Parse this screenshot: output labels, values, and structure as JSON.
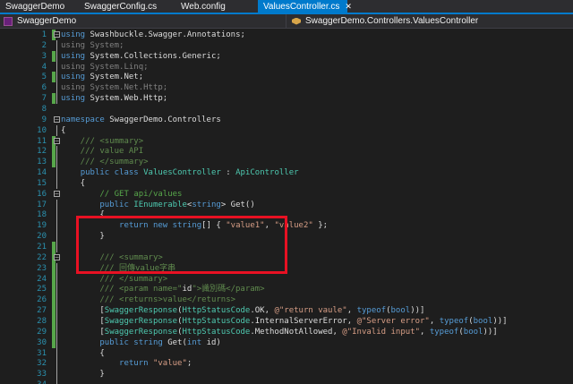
{
  "tabs": [
    {
      "label": "SwaggerDemo",
      "active": false
    },
    {
      "label": "SwaggerConfig.cs",
      "active": false
    },
    {
      "label": "Web.config",
      "active": false
    },
    {
      "label": "ValuesController.cs",
      "active": true
    }
  ],
  "nav": {
    "project": "SwaggerDemo",
    "class": "SwaggerDemo.Controllers.ValuesController"
  },
  "colors": {
    "keyword": "#569cd6",
    "type": "#4ec9b0",
    "string": "#d69d85",
    "comment": "#57a64a",
    "doc": "#608b4e",
    "plain": "#dcdcdc",
    "dim": "#808080",
    "highlight": "#e81123"
  },
  "lines": [
    {
      "n": "1",
      "fold": "open",
      "chg": true,
      "tokens": [
        {
          "t": "using ",
          "c": "keyword"
        },
        {
          "t": "Swashbuckle.Swagger.Annotations;",
          "c": "plain"
        }
      ]
    },
    {
      "n": "2",
      "fold": "line",
      "chg": false,
      "tokens": [
        {
          "t": "using System;",
          "c": "dim"
        }
      ]
    },
    {
      "n": "3",
      "fold": "line",
      "chg": true,
      "tokens": [
        {
          "t": "using ",
          "c": "keyword"
        },
        {
          "t": "System.Collections.Generic;",
          "c": "plain"
        }
      ]
    },
    {
      "n": "4",
      "fold": "line",
      "chg": false,
      "tokens": [
        {
          "t": "using System.Linq;",
          "c": "dim"
        }
      ]
    },
    {
      "n": "5",
      "fold": "line",
      "chg": true,
      "tokens": [
        {
          "t": "using ",
          "c": "keyword"
        },
        {
          "t": "System.Net;",
          "c": "plain"
        }
      ]
    },
    {
      "n": "6",
      "fold": "line",
      "chg": false,
      "tokens": [
        {
          "t": "using System.Net.Http;",
          "c": "dim"
        }
      ]
    },
    {
      "n": "7",
      "fold": "line",
      "chg": true,
      "tokens": [
        {
          "t": "using ",
          "c": "keyword"
        },
        {
          "t": "System.Web.Http;",
          "c": "plain"
        }
      ]
    },
    {
      "n": "8",
      "fold": "",
      "chg": false,
      "tokens": []
    },
    {
      "n": "9",
      "fold": "open",
      "chg": false,
      "tokens": [
        {
          "t": "namespace ",
          "c": "keyword"
        },
        {
          "t": "SwaggerDemo.Controllers",
          "c": "plain"
        }
      ]
    },
    {
      "n": "10",
      "fold": "line",
      "chg": false,
      "tokens": [
        {
          "t": "{",
          "c": "plain"
        }
      ]
    },
    {
      "n": "11",
      "fold": "open",
      "chg": true,
      "tokens": [
        {
          "t": "    /// <summary>",
          "c": "doc"
        }
      ]
    },
    {
      "n": "12",
      "fold": "line",
      "chg": true,
      "tokens": [
        {
          "t": "    /// value API",
          "c": "doc"
        }
      ]
    },
    {
      "n": "13",
      "fold": "line",
      "chg": true,
      "tokens": [
        {
          "t": "    /// </summary>",
          "c": "doc"
        }
      ]
    },
    {
      "n": "14",
      "fold": "line",
      "chg": false,
      "tokens": [
        {
          "t": "    ",
          "c": "plain"
        },
        {
          "t": "public class ",
          "c": "keyword"
        },
        {
          "t": "ValuesController",
          "c": "type"
        },
        {
          "t": " : ",
          "c": "plain"
        },
        {
          "t": "ApiController",
          "c": "type"
        }
      ]
    },
    {
      "n": "15",
      "fold": "line",
      "chg": false,
      "tokens": [
        {
          "t": "    {",
          "c": "plain"
        }
      ]
    },
    {
      "n": "16",
      "fold": "open",
      "chg": false,
      "tokens": [
        {
          "t": "        // GET api/values",
          "c": "comment"
        }
      ]
    },
    {
      "n": "17",
      "fold": "line",
      "chg": false,
      "tokens": [
        {
          "t": "        ",
          "c": "plain"
        },
        {
          "t": "public ",
          "c": "keyword"
        },
        {
          "t": "IEnumerable",
          "c": "type"
        },
        {
          "t": "<",
          "c": "plain"
        },
        {
          "t": "string",
          "c": "keyword"
        },
        {
          "t": "> Get()",
          "c": "plain"
        }
      ]
    },
    {
      "n": "18",
      "fold": "line",
      "chg": false,
      "tokens": [
        {
          "t": "        {",
          "c": "plain"
        }
      ]
    },
    {
      "n": "19",
      "fold": "line",
      "chg": false,
      "tokens": [
        {
          "t": "            ",
          "c": "plain"
        },
        {
          "t": "return new ",
          "c": "keyword"
        },
        {
          "t": "string",
          "c": "keyword"
        },
        {
          "t": "[] { ",
          "c": "plain"
        },
        {
          "t": "\"value1\"",
          "c": "string"
        },
        {
          "t": ", ",
          "c": "plain"
        },
        {
          "t": "\"value2\"",
          "c": "string"
        },
        {
          "t": " };",
          "c": "plain"
        }
      ]
    },
    {
      "n": "20",
      "fold": "line",
      "chg": false,
      "tokens": [
        {
          "t": "        }",
          "c": "plain"
        }
      ]
    },
    {
      "n": "21",
      "fold": "line",
      "chg": true,
      "tokens": []
    },
    {
      "n": "22",
      "fold": "open",
      "chg": true,
      "tokens": [
        {
          "t": "        /// <summary>",
          "c": "doc"
        }
      ]
    },
    {
      "n": "23",
      "fold": "line",
      "chg": true,
      "tokens": [
        {
          "t": "        /// 回傳value字串",
          "c": "doc"
        }
      ]
    },
    {
      "n": "24",
      "fold": "line",
      "chg": true,
      "tokens": [
        {
          "t": "        /// </summary>",
          "c": "doc"
        }
      ]
    },
    {
      "n": "25",
      "fold": "line",
      "chg": true,
      "tokens": [
        {
          "t": "        /// <param name=\"",
          "c": "doc"
        },
        {
          "t": "id",
          "c": "plain"
        },
        {
          "t": "\">識別碼</param>",
          "c": "doc"
        }
      ]
    },
    {
      "n": "26",
      "fold": "line",
      "chg": true,
      "tokens": [
        {
          "t": "        /// <returns>value</returns>",
          "c": "doc"
        }
      ]
    },
    {
      "n": "27",
      "fold": "line",
      "chg": true,
      "tokens": [
        {
          "t": "        [",
          "c": "plain"
        },
        {
          "t": "SwaggerResponse",
          "c": "type"
        },
        {
          "t": "(",
          "c": "plain"
        },
        {
          "t": "HttpStatusCode",
          "c": "type"
        },
        {
          "t": ".OK, ",
          "c": "plain"
        },
        {
          "t": "@\"return vaule\"",
          "c": "string"
        },
        {
          "t": ", ",
          "c": "plain"
        },
        {
          "t": "typeof",
          "c": "keyword"
        },
        {
          "t": "(",
          "c": "plain"
        },
        {
          "t": "bool",
          "c": "keyword"
        },
        {
          "t": "))]",
          "c": "plain"
        }
      ]
    },
    {
      "n": "28",
      "fold": "line",
      "chg": true,
      "tokens": [
        {
          "t": "        [",
          "c": "plain"
        },
        {
          "t": "SwaggerResponse",
          "c": "type"
        },
        {
          "t": "(",
          "c": "plain"
        },
        {
          "t": "HttpStatusCode",
          "c": "type"
        },
        {
          "t": ".InternalServerError, ",
          "c": "plain"
        },
        {
          "t": "@\"Server error\"",
          "c": "string"
        },
        {
          "t": ", ",
          "c": "plain"
        },
        {
          "t": "typeof",
          "c": "keyword"
        },
        {
          "t": "(",
          "c": "plain"
        },
        {
          "t": "bool",
          "c": "keyword"
        },
        {
          "t": "))]",
          "c": "plain"
        }
      ]
    },
    {
      "n": "29",
      "fold": "line",
      "chg": true,
      "tokens": [
        {
          "t": "        [",
          "c": "plain"
        },
        {
          "t": "SwaggerResponse",
          "c": "type"
        },
        {
          "t": "(",
          "c": "plain"
        },
        {
          "t": "HttpStatusCode",
          "c": "type"
        },
        {
          "t": ".MethodNotAllowed, ",
          "c": "plain"
        },
        {
          "t": "@\"Invalid input\"",
          "c": "string"
        },
        {
          "t": ", ",
          "c": "plain"
        },
        {
          "t": "typeof",
          "c": "keyword"
        },
        {
          "t": "(",
          "c": "plain"
        },
        {
          "t": "bool",
          "c": "keyword"
        },
        {
          "t": "))]",
          "c": "plain"
        }
      ]
    },
    {
      "n": "30",
      "fold": "line",
      "chg": true,
      "tokens": [
        {
          "t": "        ",
          "c": "plain"
        },
        {
          "t": "public string ",
          "c": "keyword"
        },
        {
          "t": "Get(",
          "c": "plain"
        },
        {
          "t": "int ",
          "c": "keyword"
        },
        {
          "t": "id)",
          "c": "plain"
        }
      ]
    },
    {
      "n": "31",
      "fold": "line",
      "chg": false,
      "tokens": [
        {
          "t": "        {",
          "c": "plain"
        }
      ]
    },
    {
      "n": "32",
      "fold": "line",
      "chg": false,
      "tokens": [
        {
          "t": "            ",
          "c": "plain"
        },
        {
          "t": "return ",
          "c": "keyword"
        },
        {
          "t": "\"value\"",
          "c": "string"
        },
        {
          "t": ";",
          "c": "plain"
        }
      ]
    },
    {
      "n": "33",
      "fold": "line",
      "chg": false,
      "tokens": [
        {
          "t": "        }",
          "c": "plain"
        }
      ]
    },
    {
      "n": "34",
      "fold": "line",
      "chg": false,
      "tokens": []
    }
  ]
}
